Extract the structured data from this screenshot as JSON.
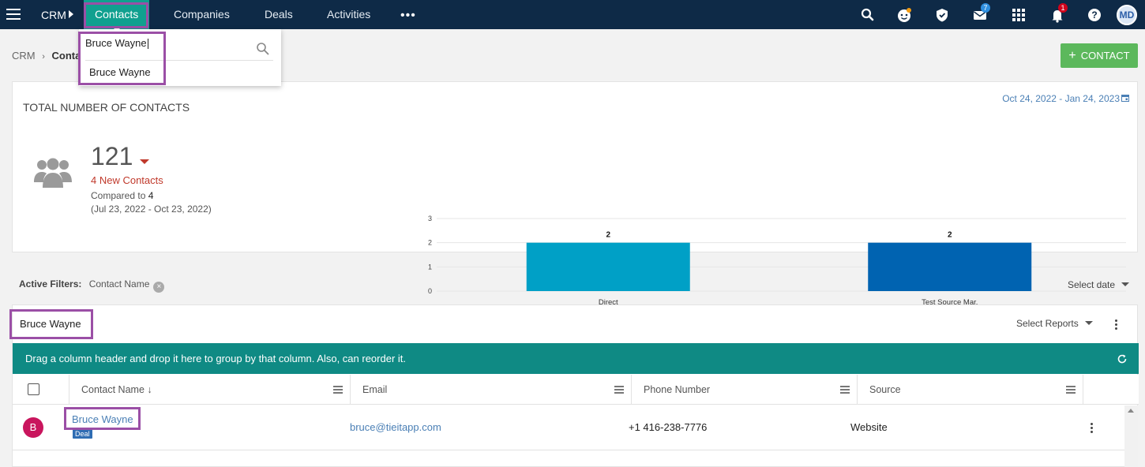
{
  "topnav": {
    "app": "CRM",
    "tabs": [
      "Contacts",
      "Companies",
      "Deals",
      "Activities"
    ],
    "more": "•••",
    "mail_badge": "7",
    "notif_badge": "1",
    "user_initials": "MD",
    "colors": {
      "bar": "#0e2a47",
      "active_tab": "#10a08f",
      "highlight": "#9b4fa6"
    }
  },
  "search": {
    "value": "Bruce Wayne",
    "result": "Bruce Wayne"
  },
  "breadcrumb": {
    "root": "CRM",
    "sep": "›",
    "current": "Conta"
  },
  "add_button": {
    "plus": "+",
    "label": "CONTACT"
  },
  "summary": {
    "title": "TOTAL NUMBER OF CONTACTS",
    "date_range": "Oct 24, 2022 - Jan 24, 2023",
    "total": "121",
    "new_contacts": "4 New Contacts",
    "compared_label": "Compared to",
    "compared_value": "4",
    "period": "(Jul 23, 2022 - Oct 23, 2022)"
  },
  "chart_data": {
    "type": "bar",
    "categories": [
      "Direct",
      "Test Source Mar."
    ],
    "values": [
      2,
      2
    ],
    "data_labels": [
      "2",
      "2"
    ],
    "colors": [
      "#00a0c6",
      "#0063b1"
    ],
    "ylim": [
      0,
      3
    ],
    "yticks": [
      "0",
      "1",
      "2",
      "3"
    ],
    "grid": true
  },
  "filters": {
    "label": "Active Filters:",
    "chip": "Contact Name",
    "chip_close": "×",
    "select_date": "Select date"
  },
  "grid": {
    "search_value": "Bruce Wayne",
    "select_reports": "Select Reports",
    "group_hint": "Drag a column header and drop it here to group by that column. Also, can reorder it.",
    "columns": [
      "Contact Name ↓",
      "Email",
      "Phone Number",
      "Source"
    ],
    "rows": [
      {
        "avatar": "B",
        "name": "Bruce Wayne",
        "tag": "Deal",
        "email": "bruce@tieitapp.com",
        "phone": "+1 416-238-7776",
        "source": "Website"
      }
    ]
  }
}
